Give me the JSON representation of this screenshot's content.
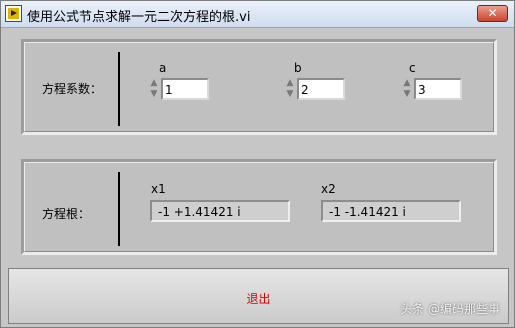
{
  "window": {
    "title": "使用公式节点求解一元二次方程的根.vi",
    "close_label": "✕"
  },
  "coefficients": {
    "label": "方程系数：",
    "a": {
      "label": "a",
      "value": "1"
    },
    "b": {
      "label": "b",
      "value": "2"
    },
    "c": {
      "label": "c",
      "value": "3"
    }
  },
  "roots": {
    "label": "方程根：",
    "x1": {
      "label": "x1",
      "value": "-1 +1.41421 i"
    },
    "x2": {
      "label": "x2",
      "value": "-1 -1.41421 i"
    }
  },
  "exit_button": {
    "label": "退出"
  },
  "watermark": "头条 @编码那些事",
  "icons": {
    "app": "labview-vi-icon",
    "close": "close-icon",
    "spin_up": "up-arrow-icon",
    "spin_down": "down-arrow-icon"
  },
  "colors": {
    "exit_text": "#e00000",
    "close_button": "#c9452f"
  }
}
